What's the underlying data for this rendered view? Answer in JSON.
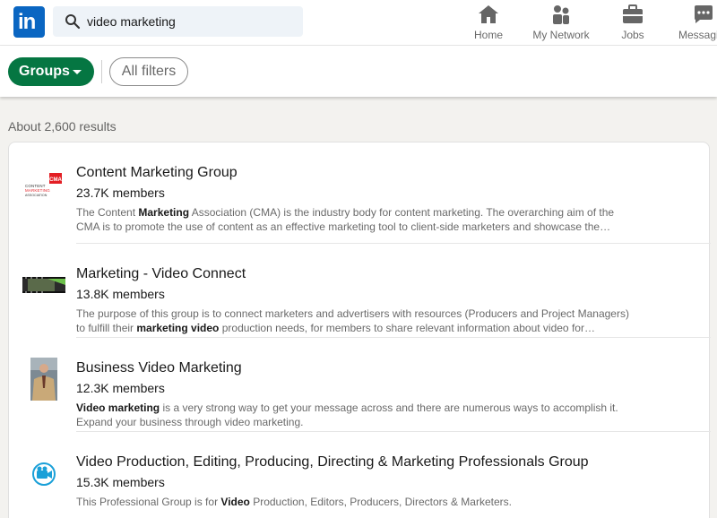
{
  "nav": {
    "search_value": "video marketing",
    "items": [
      {
        "label": "Home",
        "icon": "home-icon"
      },
      {
        "label": "My Network",
        "icon": "network-icon"
      },
      {
        "label": "Jobs",
        "icon": "briefcase-icon"
      },
      {
        "label": "Messagi",
        "icon": "messaging-icon"
      }
    ],
    "logo_text": "in"
  },
  "filters": {
    "groups_label": "Groups",
    "all_filters_label": "All filters"
  },
  "results_count": "About 2,600 results",
  "results": [
    {
      "title": "Content Marketing Group",
      "members": "23.7K members",
      "desc": [
        {
          "t": "The Content "
        },
        {
          "t": "Marketing",
          "b": true
        },
        {
          "t": " Association (CMA) is the industry body for content marketing. The overarching aim of the CMA is to promote the use of content as an effective marketing tool to client-side marketers and showcase the…"
        }
      ],
      "thumb_text": "CONTENT MARKETING ASSOCIATION",
      "thumb_badge": "CMA"
    },
    {
      "title": "Marketing - Video Connect",
      "members": "13.8K members",
      "desc": [
        {
          "t": "The purpose of this group is to connect marketers and advertisers with resources (Producers and Project Managers) to fulfill their "
        },
        {
          "t": "marketing video",
          "b": true
        },
        {
          "t": " production needs, for members to share relevant information about video for…"
        }
      ]
    },
    {
      "title": "Business Video Marketing",
      "members": "12.3K members",
      "desc": [
        {
          "t": "Video marketing",
          "b": true
        },
        {
          "t": " is a very strong way to get your message across and there are numerous ways to accomplish it. Expand your business through video marketing."
        }
      ]
    },
    {
      "title": "Video Production, Editing, Producing, Directing & Marketing Professionals Group",
      "members": "15.3K members",
      "desc": [
        {
          "t": "This Professional Group is for "
        },
        {
          "t": "Video",
          "b": true
        },
        {
          "t": " Production, Editors, Producers, Directors & Marketers."
        }
      ]
    }
  ],
  "colors": {
    "brand": "#0a66c2",
    "groups_pill": "#057642",
    "page_bg": "#f3f2ef",
    "icon_accent": "#1aa0d8"
  }
}
